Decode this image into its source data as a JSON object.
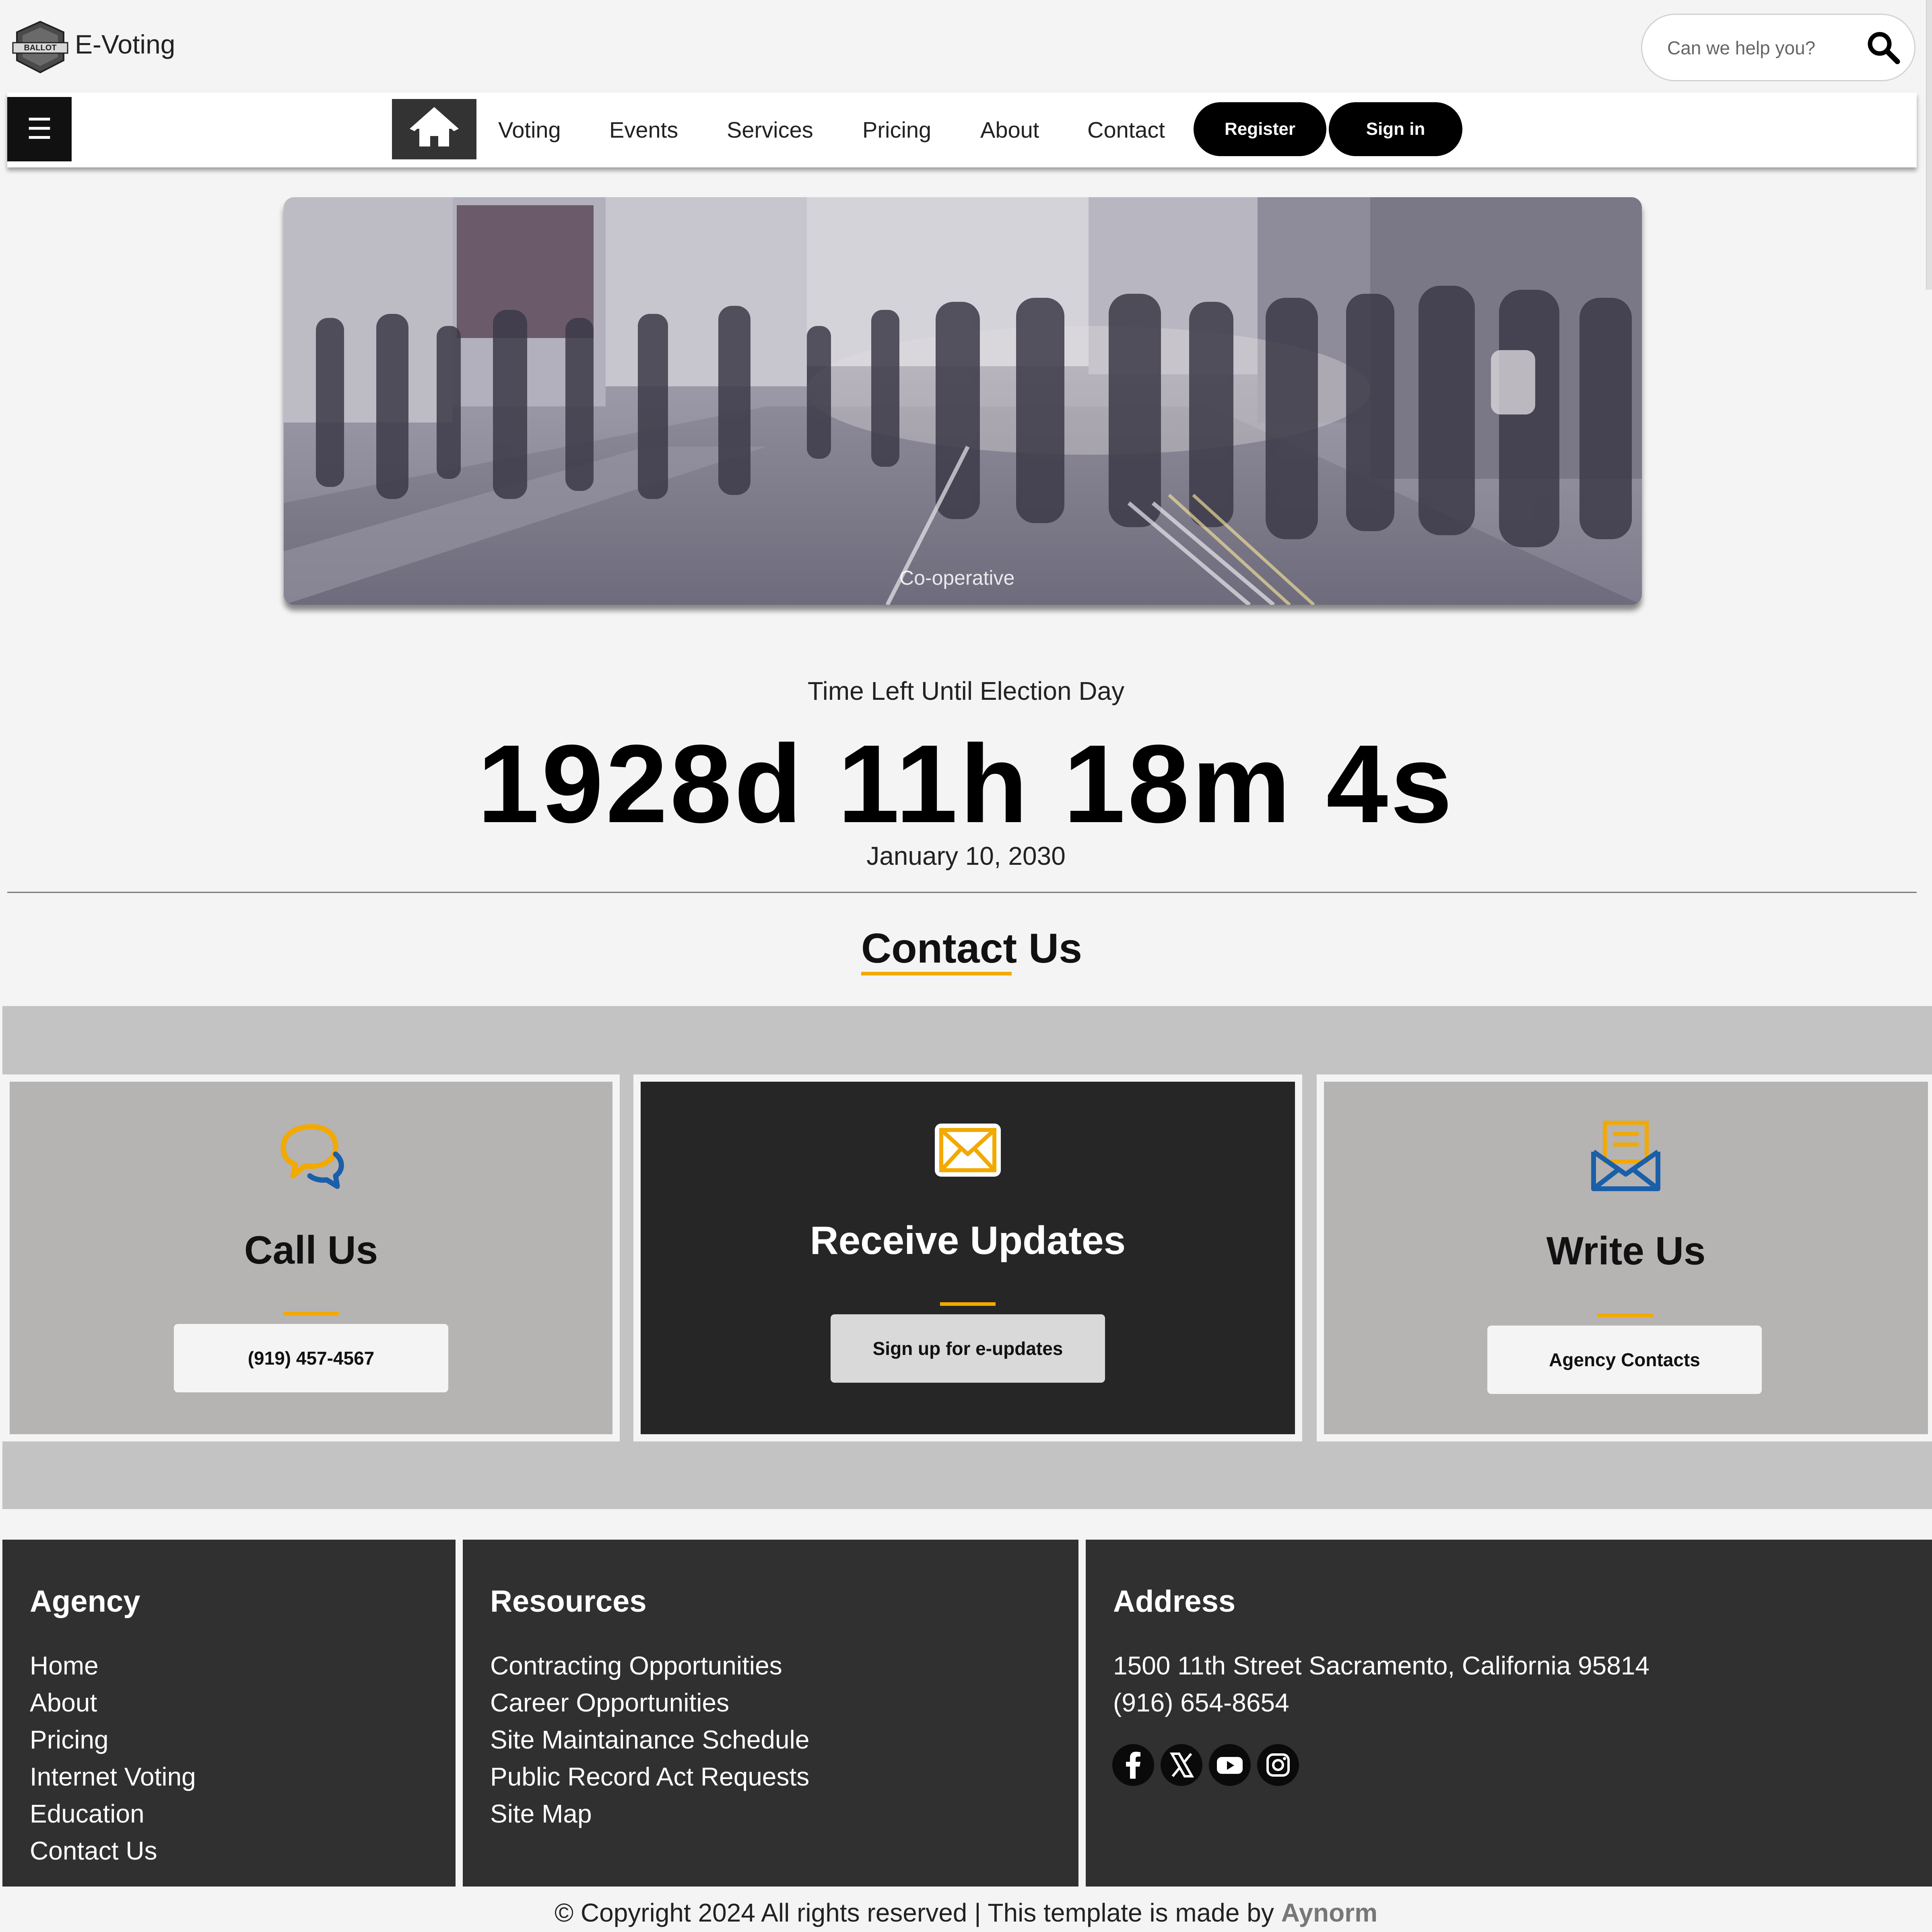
{
  "header": {
    "brand": "E-Voting",
    "logo_text": "BALLOT",
    "search_placeholder": "Can we help you?"
  },
  "nav": {
    "links": [
      "Voting",
      "Events",
      "Services",
      "Pricing",
      "About",
      "Contact"
    ],
    "register_label": "Register",
    "signin_label": "Sign in"
  },
  "hero": {
    "caption": "Co-operative"
  },
  "countdown": {
    "label": "Time Left Until Election Day",
    "value": "1928d 11h 18m 4s",
    "date": "January 10, 2030"
  },
  "contact": {
    "title": "Contact Us",
    "cards": [
      {
        "title": "Call Us",
        "button": "(919) 457-4567",
        "icon": "chat-bubbles-icon"
      },
      {
        "title": "Receive Updates",
        "button": "Sign up for e-updates",
        "icon": "mail-icon"
      },
      {
        "title": "Write Us",
        "button": "Agency Contacts",
        "icon": "open-envelope-icon"
      }
    ]
  },
  "footer": {
    "agency": {
      "title": "Agency",
      "links": [
        "Home",
        "About",
        "Pricing",
        "Internet Voting",
        "Education",
        "Contact Us"
      ]
    },
    "resources": {
      "title": "Resources",
      "links": [
        "Contracting Opportunities",
        "Career Opportunities",
        "Site Maintainance Schedule",
        "Public Record Act Requests",
        "Site Map"
      ]
    },
    "address": {
      "title": "Address",
      "street": "1500 11th Street Sacramento, California 95814",
      "phone": "(916) 654-8654",
      "social": [
        "facebook-icon",
        "x-twitter-icon",
        "youtube-icon",
        "instagram-icon"
      ]
    },
    "copyright": "© Copyright 2024 All rights reserved | This template is made by",
    "author": "Aynorm"
  },
  "colors": {
    "accent": "#f2a900",
    "icon_blue": "#1a5fa8",
    "footer_bg": "#303030",
    "card_light": "#b6b3b3",
    "card_dark": "#262626"
  }
}
